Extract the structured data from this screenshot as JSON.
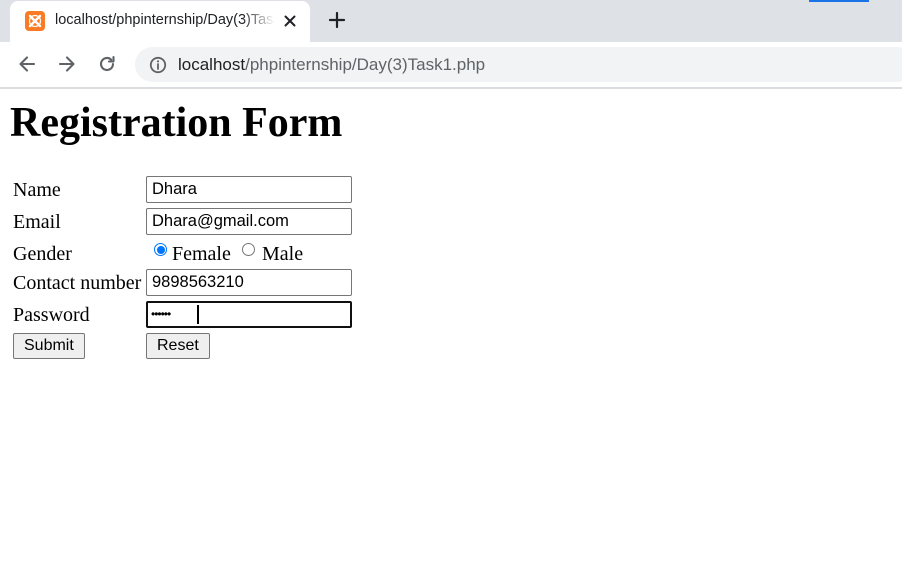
{
  "browser": {
    "tab": {
      "title": "localhost/phpinternship/Day(3)Task1.php",
      "favicon": "xampp-icon",
      "close_icon": "close-icon"
    },
    "new_tab_icon": "plus-icon",
    "nav": {
      "back_icon": "arrow-left-icon",
      "forward_icon": "arrow-right-icon",
      "reload_icon": "reload-icon",
      "site_info_icon": "info-icon"
    },
    "address_bar": {
      "host": "localhost",
      "path": "/phpinternship/Day(3)Task1.php"
    },
    "colors": {
      "tabstrip": "#dee1e6",
      "omnibox": "#f1f3f4",
      "favicon": "#fb7a24",
      "accent": "#0075ff"
    }
  },
  "page": {
    "title": "Registration Form",
    "form": {
      "name_label": "Name",
      "name_value": "Dhara",
      "email_label": "Email",
      "email_value": "Dhara@gmail.com",
      "gender_label": "Gender",
      "gender_options": [
        {
          "label": "Female",
          "checked": true
        },
        {
          "label": "Male",
          "checked": false
        }
      ],
      "contact_label": "Contact number",
      "contact_value": "9898563210",
      "password_label": "Password",
      "password_masked": "••••••",
      "submit_label": "Submit",
      "reset_label": "Reset"
    }
  }
}
